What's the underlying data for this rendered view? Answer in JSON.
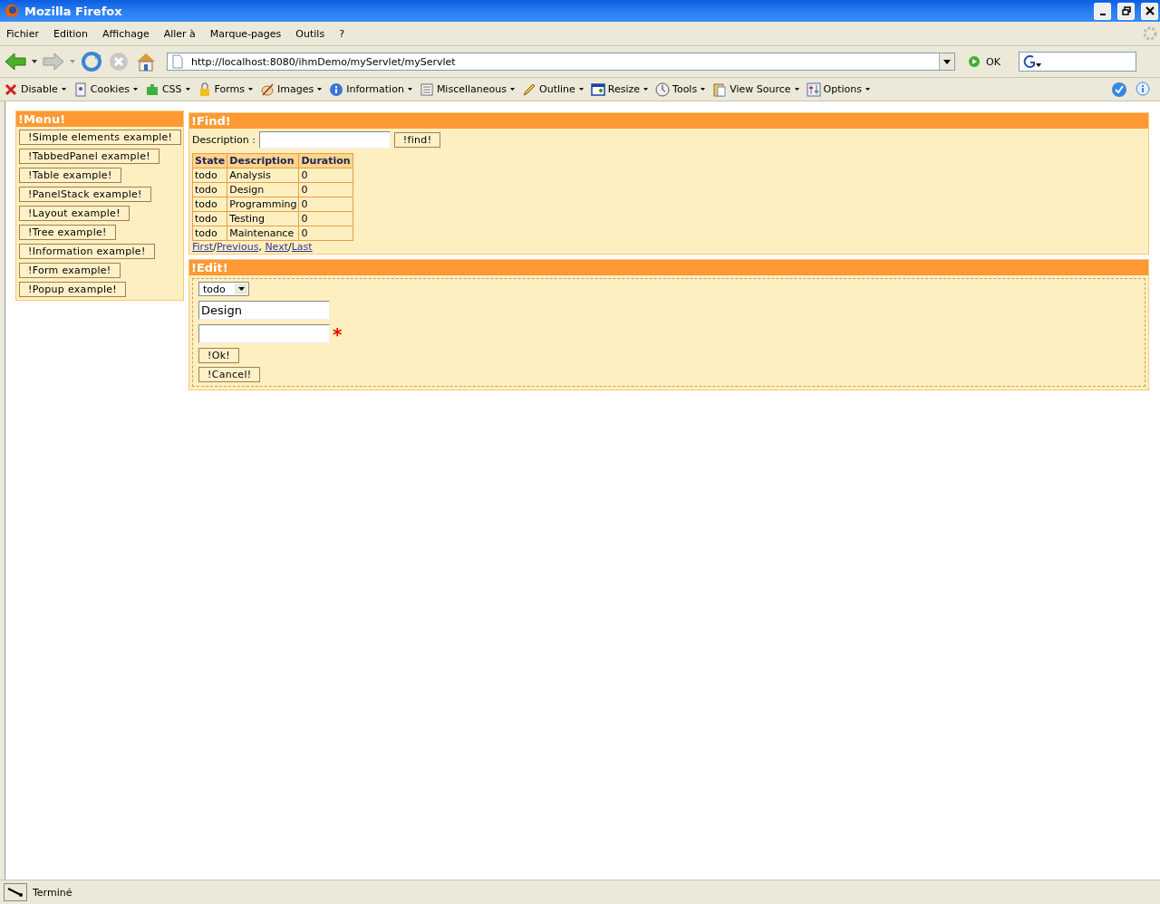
{
  "window": {
    "title": "Mozilla Firefox"
  },
  "menu_bar": [
    "Fichier",
    "Edition",
    "Affichage",
    "Aller à",
    "Marque-pages",
    "Outils",
    "?"
  ],
  "nav_toolbar": {
    "url": "http://localhost:8080/ihmDemo/myServlet/myServlet",
    "go_label": "OK"
  },
  "dev_toolbar": [
    "Disable",
    "Cookies",
    "CSS",
    "Forms",
    "Images",
    "Information",
    "Miscellaneous",
    "Outline",
    "Resize",
    "Tools",
    "View Source",
    "Options"
  ],
  "menu_panel": {
    "title": "!Menu!",
    "buttons": [
      "!Simple elements example!",
      "!TabbedPanel example!",
      "!Table example!",
      "!PanelStack example!",
      "!Layout example!",
      "!Tree example!",
      "!Information example!",
      "!Form example!",
      "!Popup example!"
    ]
  },
  "find_panel": {
    "title": "!Find!",
    "field_label": "Description :",
    "button": "!find!",
    "table": {
      "columns": [
        "State",
        "Description",
        "Duration"
      ],
      "rows": [
        [
          "todo",
          "Analysis",
          "0"
        ],
        [
          "todo",
          "Design",
          "0"
        ],
        [
          "todo",
          "Programming",
          "0"
        ],
        [
          "todo",
          "Testing",
          "0"
        ],
        [
          "todo",
          "Maintenance",
          "0"
        ]
      ]
    },
    "pager": [
      {
        "kind": "link",
        "text": "First"
      },
      {
        "kind": "sep",
        "text": "/"
      },
      {
        "kind": "link",
        "text": "Previous"
      },
      {
        "kind": "sep",
        "text": ", "
      },
      {
        "kind": "link",
        "text": "Next"
      },
      {
        "kind": "sep",
        "text": "/"
      },
      {
        "kind": "link",
        "text": "Last"
      }
    ]
  },
  "edit_panel": {
    "title": "!Edit!",
    "state_select": "todo",
    "description_value": "Design",
    "required_mark": "*",
    "buttons": [
      "!Ok!",
      "!Cancel!"
    ]
  },
  "status_bar": {
    "text": "Terminé"
  }
}
